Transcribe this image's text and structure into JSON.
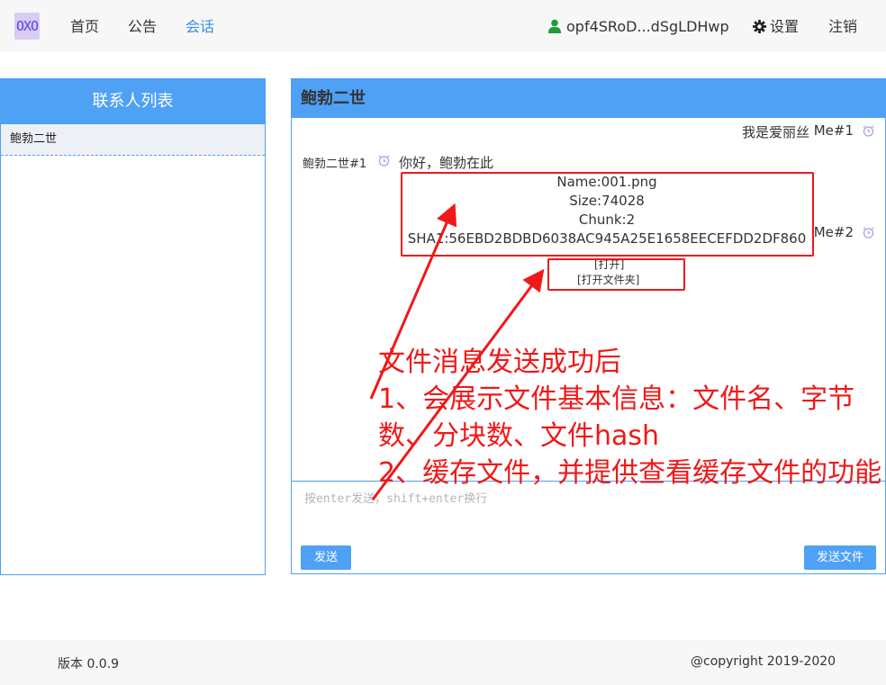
{
  "nav": {
    "logo": "OXO",
    "items": [
      {
        "label": "首页"
      },
      {
        "label": "公告"
      },
      {
        "label": "会话"
      }
    ],
    "user_name": "opf4SRoD...dSgLDHwp",
    "settings_label": "设置",
    "logout_label": "注销"
  },
  "contacts": {
    "title": "联系人列表",
    "items": [
      {
        "name": "鲍勃二世"
      }
    ]
  },
  "chat": {
    "title": "鲍勃二世",
    "messages": [
      {
        "sender": "Me#1",
        "text": "我是爱丽丝"
      },
      {
        "sender": "鲍勃二世#1",
        "text": "你好，鲍勃在此"
      },
      {
        "sender": "Me#2"
      }
    ],
    "file": {
      "name": "Name:001.png",
      "size": "Size:74028",
      "chunk": "Chunk:2",
      "sha1": "SHA1:56EBD2BDBD6038AC945A25E1658EECEFDD2DF860",
      "open_label": "[打开]",
      "open_folder_label": "[打开文件夹]"
    },
    "input_placeholder": "按enter发送，shift+enter换行",
    "send_label": "发送",
    "send_file_label": "发送文件"
  },
  "annotation": {
    "lines": [
      "文件消息发送成功后",
      "1、会展示文件基本信息：文件名、字节数、分块数、文件hash",
      "2、缓存文件，并提供查看缓存文件的功能"
    ]
  },
  "footer": {
    "version": "版本 0.0.9",
    "copyright": "@copyright 2019-2020"
  },
  "colors": {
    "accent": "#4ea1f5",
    "active_nav": "#3a8ee6",
    "annotation": "#f01818",
    "user_icon": "#1a9e3a"
  }
}
